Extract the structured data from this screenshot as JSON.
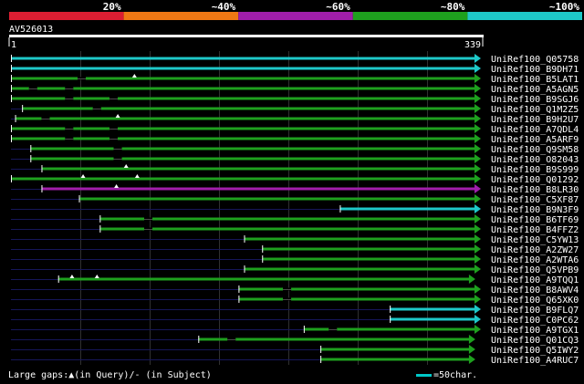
{
  "chart_data": {
    "type": "alignment",
    "query_name": "AV526013",
    "query_start": "1",
    "query_end": "339",
    "query_length": 339,
    "identity_legend": [
      {
        "label": "20%",
        "color": "#dc1e32"
      },
      {
        "label": "~40%",
        "color": "#f07814"
      },
      {
        "label": "~60%",
        "color": "#a01eaa"
      },
      {
        "label": "~80%",
        "color": "#1ea01e"
      },
      {
        "label": "~100%",
        "color": "#1ec8c8"
      }
    ],
    "colors": {
      "cyan": "#1ec8c8",
      "green": "#1ea01e",
      "purple": "#a01eaa",
      "navy": "#16165a",
      "grid": "#303030"
    },
    "hits": [
      {
        "name": "UniRef100_Q05758",
        "start": 1,
        "end": 339,
        "color": "cyan",
        "gaps_query": [],
        "gaps_subject": []
      },
      {
        "name": "UniRef100_B9DH71",
        "start": 1,
        "end": 339,
        "color": "cyan",
        "gaps_query": [],
        "gaps_subject": []
      },
      {
        "name": "UniRef100_B5LAT1",
        "start": 1,
        "end": 339,
        "color": "green",
        "gaps_query": [
          90
        ],
        "gaps_subject": [
          49
        ]
      },
      {
        "name": "UniRef100_A5AGN5",
        "start": 1,
        "end": 339,
        "color": "green",
        "gaps_query": [],
        "gaps_subject": [
          14,
          40
        ]
      },
      {
        "name": "UniRef100_B9SGJ6",
        "start": 1,
        "end": 339,
        "color": "green",
        "gaps_query": [],
        "gaps_subject": [
          40,
          72
        ]
      },
      {
        "name": "UniRef100_Q1M2Z5",
        "start": 9,
        "end": 339,
        "color": "green",
        "gaps_query": [],
        "gaps_subject": [
          60
        ]
      },
      {
        "name": "UniRef100_B9H2U7",
        "start": 4,
        "end": 339,
        "color": "green",
        "gaps_query": [
          78
        ],
        "gaps_subject": [
          23
        ]
      },
      {
        "name": "UniRef100_A7QDL4",
        "start": 1,
        "end": 339,
        "color": "green",
        "gaps_query": [],
        "gaps_subject": [
          40,
          72
        ]
      },
      {
        "name": "UniRef100_A5ARF9",
        "start": 1,
        "end": 339,
        "color": "green",
        "gaps_query": [],
        "gaps_subject": [
          40,
          72
        ]
      },
      {
        "name": "UniRef100_Q9SM58",
        "start": 15,
        "end": 339,
        "color": "green",
        "gaps_query": [],
        "gaps_subject": [
          75
        ]
      },
      {
        "name": "UniRef100_O82043",
        "start": 15,
        "end": 339,
        "color": "green",
        "gaps_query": [],
        "gaps_subject": [
          75
        ]
      },
      {
        "name": "UniRef100_B9S999",
        "start": 23,
        "end": 339,
        "color": "green",
        "gaps_query": [
          84
        ],
        "gaps_subject": []
      },
      {
        "name": "UniRef100_Q01292",
        "start": 1,
        "end": 339,
        "color": "green",
        "gaps_query": [
          53,
          92
        ],
        "gaps_subject": []
      },
      {
        "name": "UniRef100_B8LR30",
        "start": 23,
        "end": 339,
        "color": "purple",
        "gaps_query": [
          77
        ],
        "gaps_subject": []
      },
      {
        "name": "UniRef100_C5XF87",
        "start": 50,
        "end": 339,
        "color": "green",
        "gaps_query": [],
        "gaps_subject": []
      },
      {
        "name": "UniRef100_B9N3F9",
        "start": 238,
        "end": 339,
        "color": "cyan",
        "gaps_query": [],
        "gaps_subject": []
      },
      {
        "name": "UniRef100_B6TF69",
        "start": 65,
        "end": 339,
        "color": "green",
        "gaps_query": [],
        "gaps_subject": [
          97
        ]
      },
      {
        "name": "UniRef100_B4FFZ2",
        "start": 65,
        "end": 339,
        "color": "green",
        "gaps_query": [],
        "gaps_subject": [
          97
        ]
      },
      {
        "name": "UniRef100_C5YW13",
        "start": 169,
        "end": 339,
        "color": "green",
        "gaps_query": [],
        "gaps_subject": []
      },
      {
        "name": "UniRef100_A2ZW27",
        "start": 182,
        "end": 339,
        "color": "green",
        "gaps_query": [],
        "gaps_subject": []
      },
      {
        "name": "UniRef100_A2WTA6",
        "start": 182,
        "end": 339,
        "color": "green",
        "gaps_query": [],
        "gaps_subject": []
      },
      {
        "name": "UniRef100_Q5VPB9",
        "start": 169,
        "end": 339,
        "color": "green",
        "gaps_query": [],
        "gaps_subject": []
      },
      {
        "name": "UniRef100_A9TQQ1",
        "start": 35,
        "end": 335,
        "color": "green",
        "gaps_query": [
          45,
          63
        ],
        "gaps_subject": []
      },
      {
        "name": "UniRef100_B8AWV4",
        "start": 165,
        "end": 339,
        "color": "green",
        "gaps_query": [],
        "gaps_subject": [
          197
        ]
      },
      {
        "name": "UniRef100_Q65XK0",
        "start": 165,
        "end": 339,
        "color": "green",
        "gaps_query": [],
        "gaps_subject": [
          197
        ]
      },
      {
        "name": "UniRef100_B9FLQ7",
        "start": 274,
        "end": 339,
        "color": "cyan",
        "gaps_query": [],
        "gaps_subject": []
      },
      {
        "name": "UniRef100_C0PC62",
        "start": 274,
        "end": 339,
        "color": "cyan",
        "gaps_query": [],
        "gaps_subject": []
      },
      {
        "name": "UniRef100_A9TGX1",
        "start": 212,
        "end": 339,
        "color": "green",
        "gaps_query": [],
        "gaps_subject": [
          230
        ]
      },
      {
        "name": "UniRef100_Q01CQ3",
        "start": 136,
        "end": 335,
        "color": "green",
        "gaps_query": [],
        "gaps_subject": [
          157
        ]
      },
      {
        "name": "UniRef100_Q5IWY2",
        "start": 224,
        "end": 335,
        "color": "green",
        "gaps_query": [],
        "gaps_subject": []
      },
      {
        "name": "UniRef100_A4RUC7",
        "start": 224,
        "end": 335,
        "color": "green",
        "gaps_query": [],
        "gaps_subject": []
      }
    ],
    "footer_gaps": "Large gaps:▲(in Query)/- (in Subject)",
    "scale_label": "=50char."
  }
}
